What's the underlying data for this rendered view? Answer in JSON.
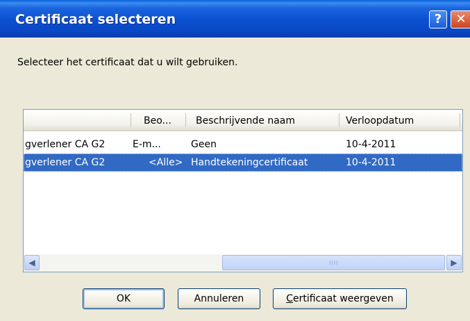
{
  "window": {
    "title": "Certificaat selecteren",
    "help_label": "?",
    "close_label": "✕"
  },
  "prompt": "Selecteer het certificaat dat u wilt gebruiken.",
  "table": {
    "columns": [
      "",
      "Beo...",
      "Beschrijvende naam",
      "Verloopdatum"
    ],
    "rows": [
      {
        "issuer": "gverlener CA G2",
        "purpose": "E-m...",
        "name": "Geen",
        "expiry": "10-4-2011",
        "selected": false
      },
      {
        "issuer": "gverlener CA G2",
        "purpose": "<Alle>",
        "name": "Handtekeningcertificaat",
        "expiry": "10-4-2011",
        "selected": true
      }
    ]
  },
  "scrollbar": {
    "left_arrow": "◀",
    "right_arrow": "▶",
    "grip": "IIII"
  },
  "buttons": {
    "ok": "OK",
    "cancel": "Annuleren",
    "view_mnemonic": "C",
    "view_rest": "ertificaat weergeven"
  }
}
